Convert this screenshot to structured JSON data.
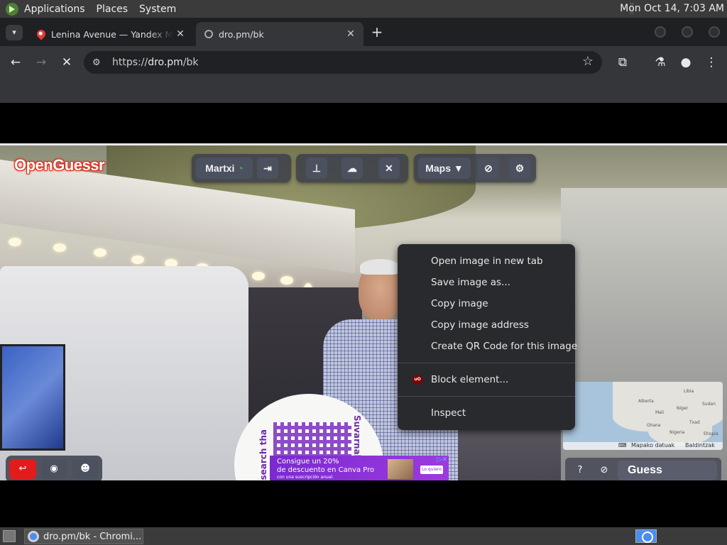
{
  "top_panel": {
    "menus": [
      "Applications",
      "Places",
      "System"
    ],
    "clock": "Mon Oct 14,  7:03 AM"
  },
  "tabs": [
    {
      "title": "Lenina Avenue — Yandex Ma",
      "favicon": "maps-pin-icon",
      "active": false
    },
    {
      "title": "dro.pm/bk",
      "favicon": "globe-icon",
      "active": true
    }
  ],
  "toolbar": {
    "url_prefix": "https://",
    "url_host": "dro.pm",
    "url_path": "/bk"
  },
  "openguessr": {
    "logo": "OpenGuessr",
    "user": "Martxi",
    "maps_label": "Maps ▼",
    "guess_label": "Guess",
    "help_label": "?"
  },
  "context_menu": {
    "items": [
      "Open image in new tab",
      "Save image as...",
      "Copy image",
      "Copy image address",
      "Create QR Code for this image",
      "Block element...",
      "Inspect"
    ]
  },
  "minimap": {
    "labels": [
      "Alberta",
      "Mali",
      "Níger",
      "Nigeria",
      "Ghana",
      "Txad",
      "Sudan",
      "Etiopia",
      "Libia"
    ],
    "footer_left": "Mapako datuak",
    "footer_right": "Baldintzak"
  },
  "ad": {
    "line1": "Consigue un 20%",
    "line2": "de descuento en Canva Pro",
    "small": "con una suscripción anual.",
    "cta": "Lo quiero"
  },
  "fan": {
    "text_left": "search tha",
    "text_right": "Suvarnab"
  },
  "taskbar": {
    "task_title": "dro.pm/bk - Chromi..."
  }
}
